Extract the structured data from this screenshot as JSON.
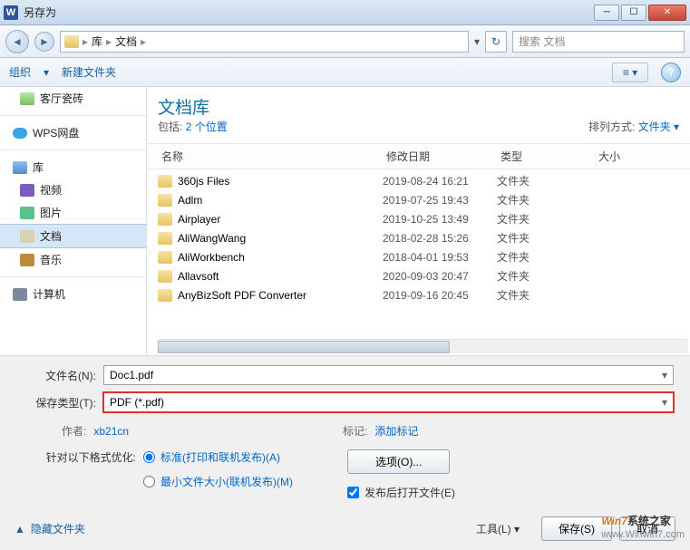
{
  "title": "另存为",
  "breadcrumb": {
    "root": "库",
    "current": "文档"
  },
  "search_placeholder": "搜索 文档",
  "toolbar": {
    "organize": "组织",
    "new_folder": "新建文件夹"
  },
  "sidebar": {
    "fav_tiles": "客厅瓷砖",
    "wps": "WPS网盘",
    "lib": "库",
    "video": "视频",
    "pic": "图片",
    "doc": "文档",
    "music": "音乐",
    "computer": "计算机"
  },
  "lib_header": {
    "title": "文档库",
    "includes_label": "包括:",
    "includes_count": "2 个位置",
    "sort_label": "排列方式:",
    "sort_value": "文件夹"
  },
  "columns": {
    "name": "名称",
    "date": "修改日期",
    "type": "类型",
    "size": "大小"
  },
  "files": [
    {
      "name": "360js Files",
      "date": "2019-08-24 16:21",
      "type": "文件夹"
    },
    {
      "name": "Adlm",
      "date": "2019-07-25 19:43",
      "type": "文件夹"
    },
    {
      "name": "Airplayer",
      "date": "2019-10-25 13:49",
      "type": "文件夹"
    },
    {
      "name": "AliWangWang",
      "date": "2018-02-28 15:26",
      "type": "文件夹"
    },
    {
      "name": "AliWorkbench",
      "date": "2018-04-01 19:53",
      "type": "文件夹"
    },
    {
      "name": "Allavsoft",
      "date": "2020-09-03 20:47",
      "type": "文件夹"
    },
    {
      "name": "AnyBizSoft PDF Converter",
      "date": "2019-09-16 20:45",
      "type": "文件夹"
    }
  ],
  "form": {
    "filename_label": "文件名(N):",
    "filename_value": "Doc1.pdf",
    "filetype_label": "保存类型(T):",
    "filetype_value": "PDF (*.pdf)",
    "author_label": "作者:",
    "author_value": "xb21cn",
    "tag_label": "标记:",
    "tag_value": "添加标记"
  },
  "optimize": {
    "label": "针对以下格式优化:",
    "radio1": "标准(打印和联机发布)(A)",
    "radio2": "最小文件大小(联机发布)(M)",
    "options_btn": "选项(O)...",
    "open_after": "发布后打开文件(E)"
  },
  "footer": {
    "hide_folders": "隐藏文件夹",
    "tools": "工具(L)",
    "save": "保存(S)",
    "cancel": "取消"
  },
  "watermark": {
    "brand": "Win7",
    "cn": "系统之家",
    "url": "www.Winwin7.com"
  }
}
